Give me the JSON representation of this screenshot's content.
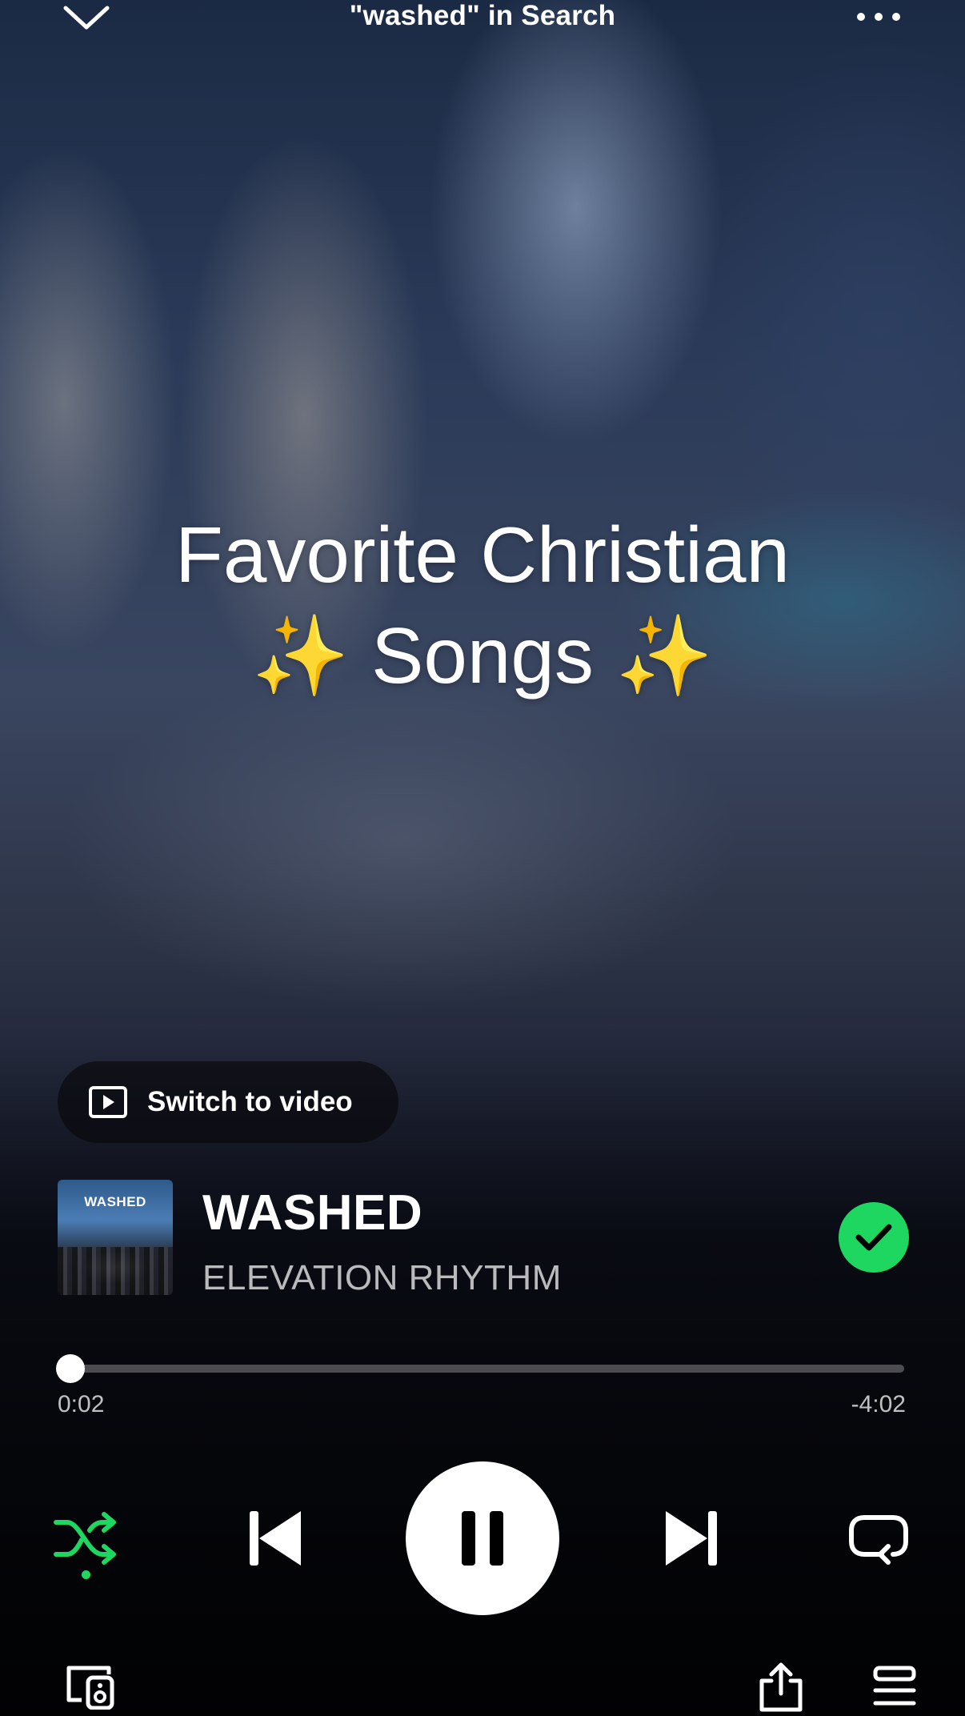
{
  "header": {
    "context_title": "\"washed\" in Search",
    "collapse_icon": "chevron-down-icon",
    "more_icon": "more-horizontal-icon"
  },
  "canvas": {
    "line1": "Favorite Christian",
    "line2": "✨ Songs ✨"
  },
  "switch_to_video": {
    "label": "Switch to video",
    "icon": "video-icon"
  },
  "track": {
    "cover_text": "WASHED",
    "title": "WASHED",
    "artist": "ELEVATION RHYTHM",
    "saved": true
  },
  "progress": {
    "elapsed": "0:02",
    "remaining": "-4:02",
    "fraction": 0.008
  },
  "controls": {
    "shuffle_on": true,
    "state": "playing"
  },
  "colors": {
    "accent": "#1ed760",
    "text": "#ffffff"
  }
}
